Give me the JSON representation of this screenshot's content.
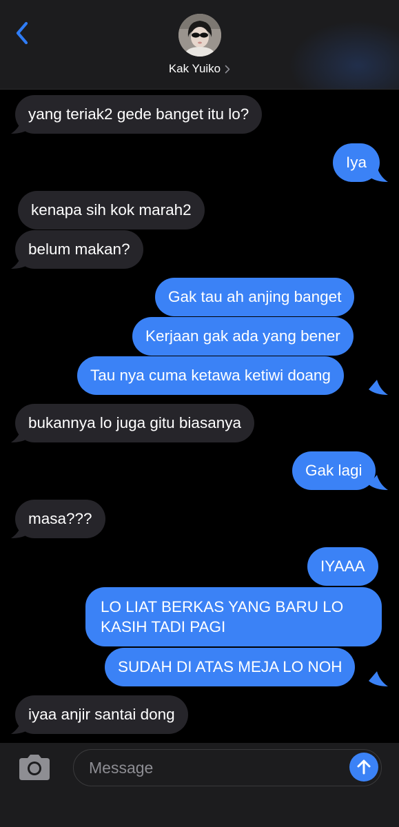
{
  "header": {
    "contact_name": "Kak Yuiko"
  },
  "colors": {
    "incoming_bubble": "#26252a",
    "outgoing_bubble": "#3b82f6",
    "accent": "#2f7cf6",
    "header_bg": "#1c1c1e"
  },
  "messages": [
    {
      "direction": "incoming",
      "text": "yang teriak2 gede banget itu lo?"
    },
    {
      "direction": "outgoing",
      "text": "Iya"
    },
    {
      "direction": "incoming",
      "text": "kenapa sih kok marah2"
    },
    {
      "direction": "incoming",
      "text": "belum makan?"
    },
    {
      "direction": "outgoing",
      "text": "Gak tau ah anjing banget"
    },
    {
      "direction": "outgoing",
      "text": "Kerjaan gak ada yang bener"
    },
    {
      "direction": "outgoing",
      "text": "Tau nya cuma ketawa ketiwi doang"
    },
    {
      "direction": "incoming",
      "text": "bukannya lo juga gitu biasanya"
    },
    {
      "direction": "outgoing",
      "text": "Gak lagi"
    },
    {
      "direction": "incoming",
      "text": "masa???"
    },
    {
      "direction": "outgoing",
      "text": "IYAAA"
    },
    {
      "direction": "outgoing",
      "text": "LO LIAT BERKAS YANG BARU LO KASIH TADI PAGI"
    },
    {
      "direction": "outgoing",
      "text": "SUDAH DI ATAS MEJA LO NOH"
    },
    {
      "direction": "incoming",
      "text": "iyaa anjir santai dong"
    }
  ],
  "composer": {
    "placeholder": "Message",
    "value": ""
  },
  "icons": {
    "back": "chevron-left-icon",
    "contact_chevron": "chevron-right-icon",
    "camera": "camera-icon",
    "send": "arrow-up-icon"
  }
}
